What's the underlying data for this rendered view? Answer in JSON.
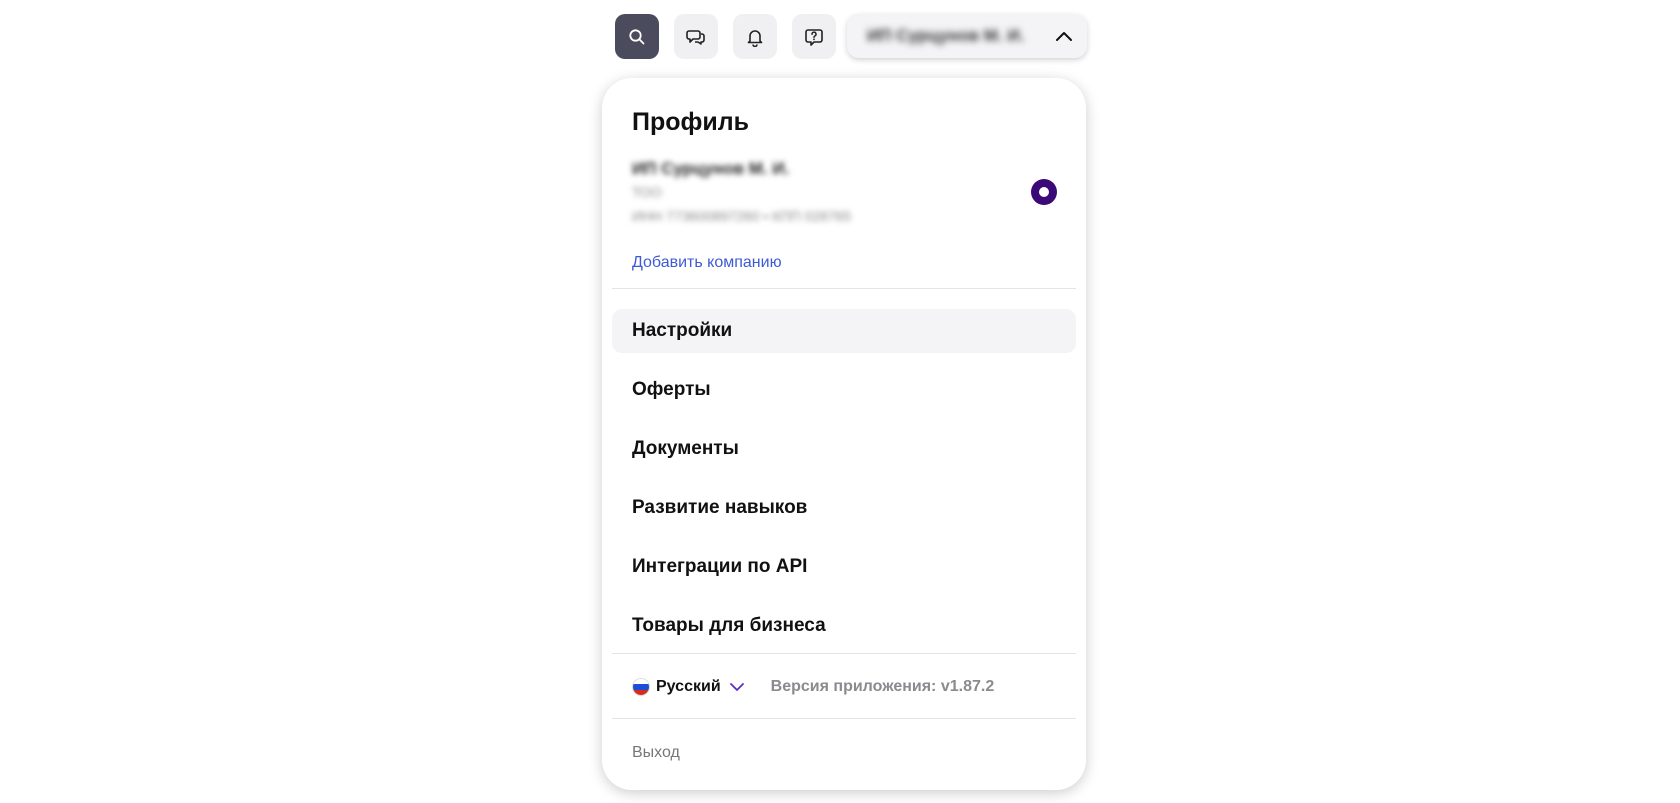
{
  "topbar": {
    "account_name": "ИП Сурцунов М. И.",
    "icons": [
      "search-icon",
      "chat-icon",
      "bell-icon",
      "help-icon",
      "chevron-up-icon"
    ]
  },
  "profile": {
    "title": "Профиль",
    "company_name": "ИП Сурцунов М. И.",
    "company_type": "ТОО",
    "company_details": "ИНН 773600897260 • КПП 028765",
    "add_company": "Добавить компанию"
  },
  "menu": [
    {
      "label": "Настройки"
    },
    {
      "label": "Оферты"
    },
    {
      "label": "Документы"
    },
    {
      "label": "Развитие навыков"
    },
    {
      "label": "Интеграции по API"
    },
    {
      "label": "Товары для бизнеса"
    }
  ],
  "footer": {
    "language": "Русский",
    "version": "Версия приложения: v1.87.2",
    "logout": "Выход"
  },
  "colors": {
    "accent_purple": "#3b0a78",
    "link_blue": "#3f5ad6",
    "search_button": "#4a4b5c"
  }
}
